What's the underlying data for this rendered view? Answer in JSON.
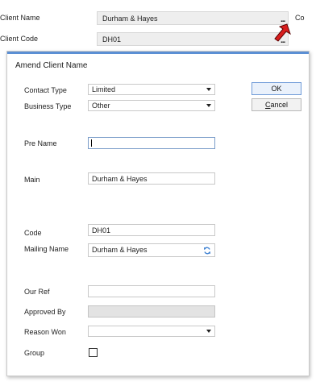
{
  "background_window": {
    "client_name_label": "Client Name",
    "client_name_value": "Durham & Hayes",
    "client_code_label": "Client Code",
    "client_code_value": "DH01",
    "ellipsis": "...",
    "cut_label": "Co"
  },
  "dialog": {
    "title": "Amend Client Name",
    "contact_type": {
      "label": "Contact Type",
      "value": "Limited"
    },
    "business_type": {
      "label": "Business Type",
      "value": "Other"
    },
    "pre_name": {
      "label": "Pre Name",
      "value": ""
    },
    "main": {
      "label": "Main",
      "value": "Durham & Hayes"
    },
    "code": {
      "label": "Code",
      "value": "DH01"
    },
    "mailing_name": {
      "label": "Mailing Name",
      "value": "Durham & Hayes"
    },
    "our_ref": {
      "label": "Our Ref",
      "value": ""
    },
    "approved_by": {
      "label": "Approved By",
      "value": ""
    },
    "reason_won": {
      "label": "Reason Won",
      "value": ""
    },
    "group": {
      "label": "Group",
      "checked": false
    }
  },
  "buttons": {
    "ok": "OK",
    "cancel_first": "C",
    "cancel_rest": "ancel"
  },
  "colors": {
    "accent": "#5b8fd4",
    "arrow": "#d81d1d"
  }
}
